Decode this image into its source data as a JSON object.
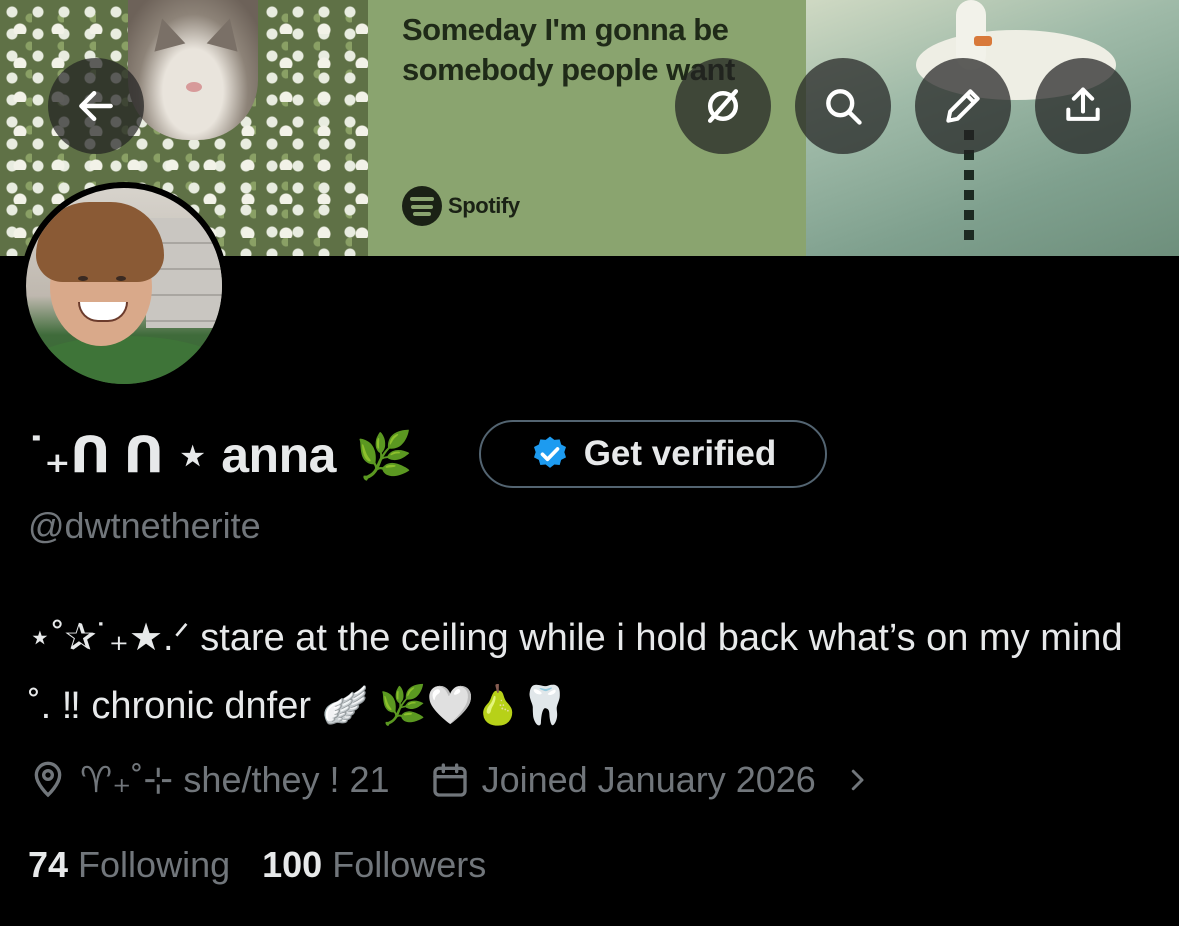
{
  "banner": {
    "lyric": "Someday I'm gonna be somebody people want",
    "brand": "Spotify"
  },
  "controls": {
    "back": "arrow-left-icon",
    "grok": "slash-circle-icon",
    "search": "search-icon",
    "edit": "pencil-icon",
    "share": "share-icon"
  },
  "profile": {
    "display_name": "˙₊ᑎ ᑎ ⋆ anna",
    "name_emoji": "🌿",
    "verify_label": "Get verified",
    "handle": "@dwtnetherite",
    "bio": "⋆˚✰˙₊★.ᐟ stare at the ceiling while i hold back what’s on my mind ˚. ‼︎ chronic dnfer 🪽 🌿🤍🍐🦷",
    "location": "♈︎₊˚⊹ she/they ! 21",
    "joined": "Joined January 2026",
    "following_count": "74",
    "following_label": "Following",
    "followers_count": "100",
    "followers_label": "Followers"
  },
  "colors": {
    "background": "#000000",
    "text_primary": "#e7e9ea",
    "text_secondary": "#71767b",
    "verified_blue": "#1d9bf0",
    "border": "#536471"
  }
}
